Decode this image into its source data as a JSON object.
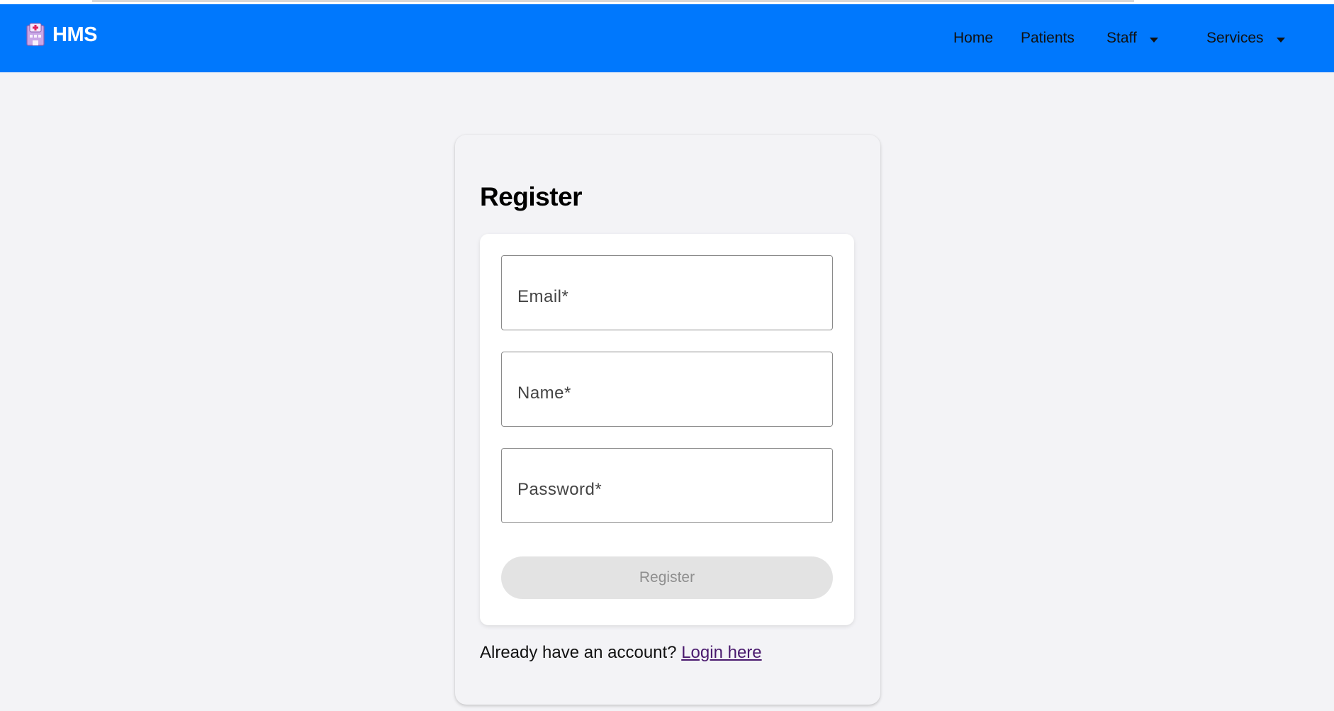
{
  "app": {
    "brand_name": "HMS",
    "brand_icon": "hospital-building-icon",
    "accent_color": "#0078fd"
  },
  "nav": {
    "home": "Home",
    "patients": "Patients",
    "staff": "Staff",
    "services": "Services"
  },
  "register": {
    "title": "Register",
    "fields": {
      "email_label": "Email*",
      "name_label": "Name*",
      "password_label": "Password*"
    },
    "submit_label": "Register",
    "submit_disabled": true,
    "login_prompt": "Already have an account?",
    "login_link": "Login here"
  }
}
